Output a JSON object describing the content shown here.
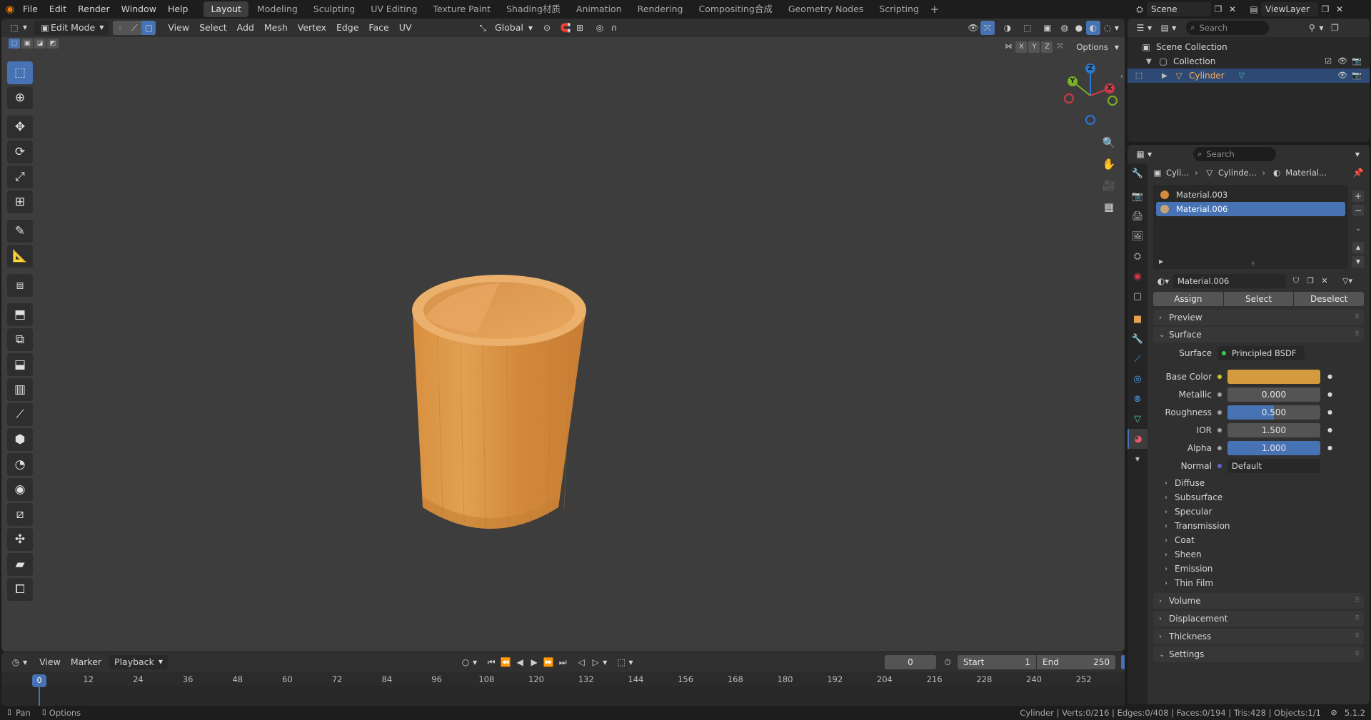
{
  "topbar": {
    "menus": [
      "File",
      "Edit",
      "Render",
      "Window",
      "Help"
    ],
    "workspaces": [
      "Layout",
      "Modeling",
      "Sculpting",
      "UV Editing",
      "Texture Paint",
      "Shading材质",
      "Animation",
      "Rendering",
      "Compositing合成",
      "Geometry Nodes",
      "Scripting"
    ],
    "active_workspace": "Layout",
    "scene": "Scene",
    "view_layer": "ViewLayer"
  },
  "viewport": {
    "mode": "Edit Mode",
    "menus": [
      "View",
      "Select",
      "Add",
      "Mesh",
      "Vertex",
      "Edge",
      "Face",
      "UV"
    ],
    "transform_orientation": "Global",
    "options_label": "Options",
    "axis_x": "X",
    "axis_y": "Y",
    "axis_z": "Z",
    "gizmo_labels": {
      "z": "Z",
      "y": "Y",
      "x": "X"
    },
    "object_color": "#d4893f"
  },
  "timeline": {
    "menus": [
      "View",
      "Marker"
    ],
    "playback": "Playback",
    "current_frame": "0",
    "start_label": "Start",
    "start_value": "1",
    "end_label": "End",
    "end_value": "250",
    "ticks": [
      "0",
      "12",
      "24",
      "36",
      "48",
      "60",
      "72",
      "84",
      "96",
      "108",
      "120",
      "132",
      "144",
      "156",
      "168",
      "180",
      "192",
      "204",
      "216",
      "228",
      "240",
      "252"
    ]
  },
  "statusbar": {
    "left_pan": "Pan",
    "left_options": "Options",
    "stats": "Cylinder | Verts:0/216 | Edges:0/408 | Faces:0/194 | Tris:428 | Objects:1/1",
    "version": "5.1.2"
  },
  "outliner": {
    "search_placeholder": "Search",
    "scene_collection": "Scene Collection",
    "collection": "Collection",
    "object": "Cylinder"
  },
  "properties": {
    "search_placeholder": "Search",
    "breadcrumb": [
      "Cyli...",
      "Cylinde...",
      "Material..."
    ],
    "materials": [
      "Material.003",
      "Material.006"
    ],
    "selected_material": "Material.006",
    "material_name": "Material.006",
    "buttons": {
      "assign": "Assign",
      "select": "Select",
      "deselect": "Deselect"
    },
    "panels": {
      "preview": "Preview",
      "surface": "Surface",
      "volume": "Volume",
      "displacement": "Displacement",
      "thickness": "Thickness",
      "settings": "Settings"
    },
    "surface": {
      "surface_label": "Surface",
      "surface_value": "Principled BSDF",
      "base_color_label": "Base Color",
      "base_color": "#d49a3e",
      "metallic_label": "Metallic",
      "metallic": "0.000",
      "roughness_label": "Roughness",
      "roughness": "0.500",
      "roughness_fill": 0.5,
      "ior_label": "IOR",
      "ior": "1.500",
      "alpha_label": "Alpha",
      "alpha": "1.000",
      "alpha_fill": 1.0,
      "normal_label": "Normal",
      "normal": "Default"
    },
    "subpanels": [
      "Diffuse",
      "Subsurface",
      "Specular",
      "Transmission",
      "Coat",
      "Sheen",
      "Emission",
      "Thin Film"
    ]
  }
}
